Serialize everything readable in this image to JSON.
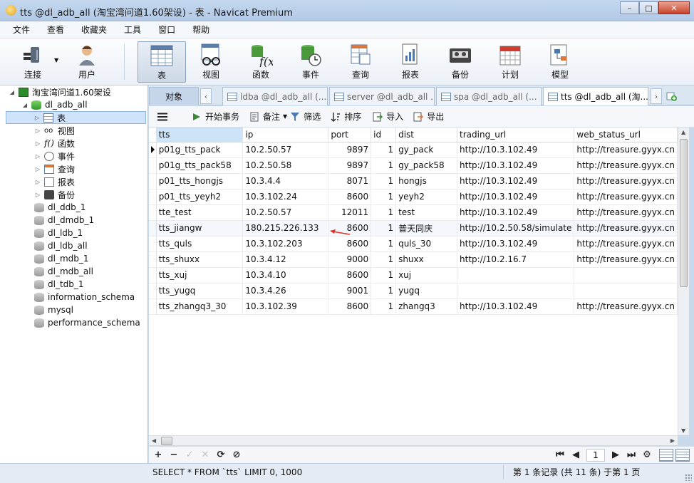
{
  "window": {
    "title": "tts @dl_adb_all (淘宝湾问道1.60架设) - 表 - Navicat Premium",
    "min_label": "–",
    "max_label": "□",
    "close_label": "✕"
  },
  "menu": [
    "文件",
    "查看",
    "收藏夹",
    "工具",
    "窗口",
    "帮助"
  ],
  "toolbar": {
    "connect": "连接",
    "user": "用户",
    "table": "表",
    "view": "视图",
    "function": "函数",
    "event": "事件",
    "query": "查询",
    "report": "报表",
    "backup": "备份",
    "schedule": "计划",
    "model": "模型"
  },
  "tree": {
    "connection": "淘宝湾问道1.60架设",
    "database": "dl_adb_all",
    "children": [
      "表",
      "视图",
      "函数",
      "事件",
      "查询",
      "报表",
      "备份"
    ],
    "databases": [
      "dl_ddb_1",
      "dl_dmdb_1",
      "dl_ldb_1",
      "dl_ldb_all",
      "dl_mdb_1",
      "dl_mdb_all",
      "dl_tdb_1",
      "information_schema",
      "mysql",
      "performance_schema"
    ]
  },
  "tabs": {
    "objects": "对象",
    "items": [
      "ldba @dl_adb_all (...",
      "server @dl_adb_all ...",
      "spa @dl_adb_all (...",
      "tts @dl_adb_all (淘..."
    ]
  },
  "subtoolbar": {
    "begin_tx": "开始事务",
    "memo": "备注",
    "filter": "筛选",
    "sort": "排序",
    "import": "导入",
    "export": "导出"
  },
  "grid": {
    "columns": [
      "tts",
      "ip",
      "port",
      "id",
      "dist",
      "trading_url",
      "web_status_url"
    ],
    "rows": [
      [
        "p01g_tts_pack",
        "10.2.50.57",
        "9897",
        "1",
        "gy_pack",
        "http://10.3.102.49",
        "http://treasure.gyyx.cn"
      ],
      [
        "p01g_tts_pack58",
        "10.2.50.58",
        "9897",
        "1",
        "gy_pack58",
        "http://10.3.102.49",
        "http://treasure.gyyx.cn"
      ],
      [
        "p01_tts_hongjs",
        "10.3.4.4",
        "8071",
        "1",
        "hongjs",
        "http://10.3.102.49",
        "http://treasure.gyyx.cn"
      ],
      [
        "p01_tts_yeyh2",
        "10.3.102.24",
        "8600",
        "1",
        "yeyh2",
        "http://10.3.102.49",
        "http://treasure.gyyx.cn"
      ],
      [
        "tte_test",
        "10.2.50.57",
        "12011",
        "1",
        "test",
        "http://10.3.102.49",
        "http://treasure.gyyx.cn"
      ],
      [
        "tts_jiangw",
        "180.215.226.133",
        "8600",
        "1",
        "普天同庆",
        "http://10.2.50.58/simulate",
        "http://treasure.gyyx.cn"
      ],
      [
        "tts_quls",
        "10.3.102.203",
        "8600",
        "1",
        "quls_30",
        "http://10.3.102.49",
        "http://treasure.gyyx.cn"
      ],
      [
        "tts_shuxx",
        "10.3.4.12",
        "9000",
        "1",
        "shuxx",
        "http://10.2.16.7",
        "http://treasure.gyyx.cn"
      ],
      [
        "tts_xuj",
        "10.3.4.10",
        "8600",
        "1",
        "xuj",
        "",
        ""
      ],
      [
        "tts_yugq",
        "10.3.4.26",
        "9001",
        "1",
        "yugq",
        "",
        ""
      ],
      [
        "tts_zhangq3_30",
        "10.3.102.39",
        "8600",
        "1",
        "zhangq3",
        "http://10.3.102.49",
        "http://treasure.gyyx.cn"
      ]
    ]
  },
  "navbar": {
    "add": "+",
    "delete": "−",
    "apply": "✓",
    "cancel": "✕",
    "refresh": "⟳",
    "stop": "⊘",
    "first": "⏮",
    "prev": "◀",
    "page": "1",
    "next": "▶",
    "last": "⏭",
    "settings": "⚙"
  },
  "status": {
    "sql": "SELECT * FROM `tts` LIMIT 0, 1000",
    "records": "第 1 条记录 (共 11 条) 于第 1 页"
  },
  "colors": {
    "accent": "#cfe3fa",
    "annotation_arrow": "#e0302a"
  }
}
